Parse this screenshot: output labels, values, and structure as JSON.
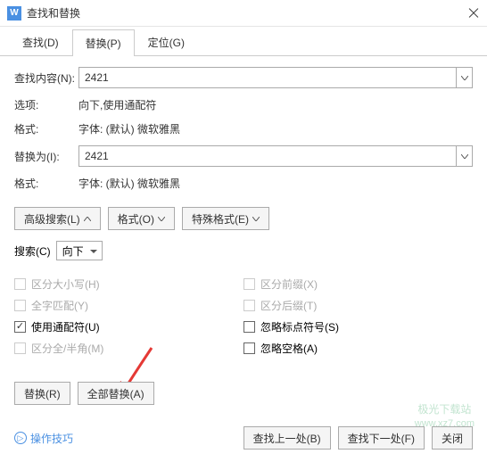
{
  "window": {
    "title": "查找和替换"
  },
  "tabs": {
    "find": "查找(D)",
    "replace": "替换(P)",
    "locate": "定位(G)"
  },
  "form": {
    "find_label": "查找内容(N):",
    "find_value": "2421",
    "options_label": "选项:",
    "options_value": "向下,使用通配符",
    "find_format_label": "格式:",
    "find_format_value": "字体: (默认) 微软雅黑",
    "replace_label": "替换为(I):",
    "replace_value": "2421",
    "replace_format_label": "格式:",
    "replace_format_value": "字体: (默认) 微软雅黑"
  },
  "controls": {
    "advanced": "高级搜索(L)",
    "format_btn": "格式(O)",
    "special": "特殊格式(E)",
    "search_label": "搜索(C)",
    "search_dir": "向下"
  },
  "checks": {
    "case": "区分大小写(H)",
    "whole": "全字匹配(Y)",
    "wildcard": "使用通配符(U)",
    "fullhalf": "区分全/半角(M)",
    "prefix": "区分前缀(X)",
    "suffix": "区分后缀(T)",
    "ignore_punct": "忽略标点符号(S)",
    "ignore_space": "忽略空格(A)"
  },
  "footer": {
    "replace_btn": "替换(R)",
    "replace_all": "全部替换(A)",
    "help": "操作技巧",
    "find_prev": "查找上一处(B)",
    "find_next": "查找下一处(F)",
    "close": "关闭"
  },
  "watermark": {
    "brand": "极光下载站",
    "url": "www.xz7.com"
  }
}
